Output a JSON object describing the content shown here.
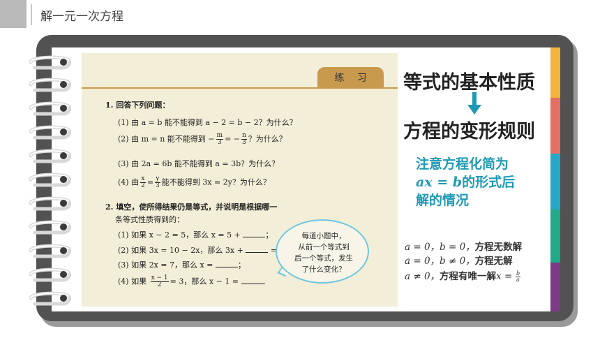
{
  "header": {
    "title": "解一元一次方程"
  },
  "colors": {
    "frame": "#525252",
    "accent_teal": "#1f9ab4",
    "tabs": [
      "#f0b43c",
      "#e37063",
      "#29a7c7",
      "#22a98a",
      "#7d3a85"
    ]
  },
  "exercise": {
    "badge": "练习",
    "q1": {
      "title": "1. 回答下列问题：",
      "p1": "(1) 由 a = b 能不能得到 a − 2 = b − 2？为什么？",
      "p2_pre": "(2) 由 m = n 能不能得到 −",
      "p2_frac1_num": "m",
      "p2_frac1_den": "3",
      "p2_mid": "= −",
      "p2_frac2_num": "n",
      "p2_frac2_den": "3",
      "p2_post": "？为什么？",
      "p3": "(3) 由 2a = 6b 能不能得到 a = 3b？为什么？",
      "p4_pre": "(4) 由",
      "p4_frac1_num": "x",
      "p4_frac1_den": "2",
      "p4_mid": "=",
      "p4_frac2_num": "y",
      "p4_frac2_den": "3",
      "p4_post": "能不能得到 3x = 2y？为什么？"
    },
    "q2": {
      "title_line1": "2. 填空，使所得结果仍是等式，并说明是根据哪一",
      "title_line2": "条等式性质得到的：",
      "p1_pre": "(1) 如果 x − 2 = 5，那么 x = 5 +",
      "p1_post": "；",
      "p2_pre": "(2) 如果 3x = 10 − 2x，那么 3x +",
      "p2_post": "= 10；",
      "p3_pre": "(3) 如果 2x = 7，那么 x =",
      "p3_post": "；",
      "p4_pre": "(4) 如果",
      "p4_frac_num": "x − 1",
      "p4_frac_den": "2",
      "p4_mid": "= 3，那么 x − 1 =",
      "p4_post": "."
    },
    "bubble": [
      "每道小题中，",
      "从前一个等式到",
      "后一个等式，发生",
      "了什么变化？"
    ]
  },
  "right": {
    "title1": "等式的基本性质",
    "title2": "方程的变形规则",
    "note_line1": "注意方程化简为",
    "note_line2_math": "ax = b",
    "note_line2_text": "的形式后",
    "note_line3": "解的情况",
    "case1_math": "a = 0，b = 0，",
    "case1_text": "方程无数解",
    "case2_math": "a = 0，b ≠ 0，",
    "case2_text": "方程无解",
    "case3_math": "a ≠ 0，",
    "case3_text": "方程有唯一解",
    "case3_x": "x =",
    "case3_frac_num": "b",
    "case3_frac_den": "a"
  }
}
